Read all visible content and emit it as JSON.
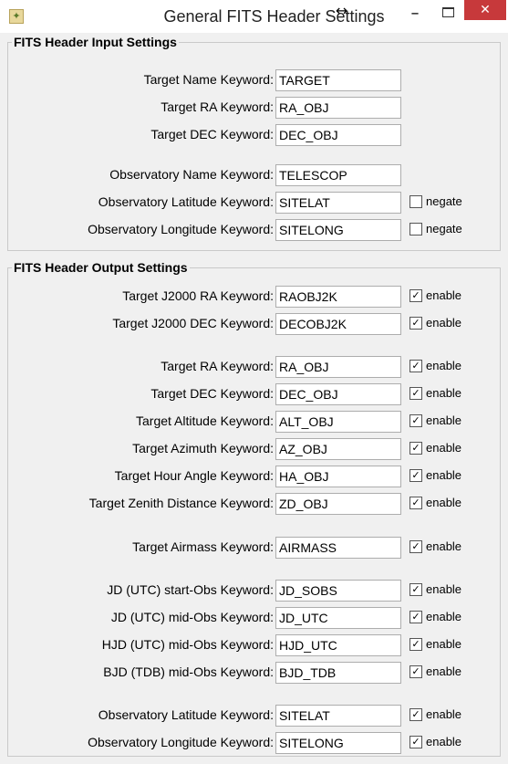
{
  "window": {
    "title": "General FITS Header Settings",
    "minimize_glyph": "–",
    "close_glyph": "✕",
    "resize_cursor_glyph": "↔"
  },
  "input_settings": {
    "legend": "FITS Header Input Settings",
    "rows": [
      {
        "label": "Target Name Keyword:",
        "value": "TARGET"
      },
      {
        "label": "Target RA Keyword:",
        "value": "RA_OBJ"
      },
      {
        "label": "Target DEC Keyword:",
        "value": "DEC_OBJ"
      },
      {
        "label": "Observatory Name Keyword:",
        "value": "TELESCOP"
      },
      {
        "label": "Observatory Latitude Keyword:",
        "value": "SITELAT",
        "checkbox_label": "negate",
        "checked": false
      },
      {
        "label": "Observatory Longitude Keyword:",
        "value": "SITELONG",
        "checkbox_label": "negate",
        "checked": false
      }
    ]
  },
  "output_settings": {
    "legend": "FITS Header Output Settings",
    "rows": [
      {
        "label": "Target J2000 RA Keyword:",
        "value": "RAOBJ2K",
        "checkbox_label": "enable",
        "checked": true
      },
      {
        "label": "Target J2000 DEC Keyword:",
        "value": "DECOBJ2K",
        "checkbox_label": "enable",
        "checked": true
      },
      {
        "label": "Target RA Keyword:",
        "value": "RA_OBJ",
        "checkbox_label": "enable",
        "checked": true
      },
      {
        "label": "Target DEC Keyword:",
        "value": "DEC_OBJ",
        "checkbox_label": "enable",
        "checked": true
      },
      {
        "label": "Target Altitude Keyword:",
        "value": "ALT_OBJ",
        "checkbox_label": "enable",
        "checked": true
      },
      {
        "label": "Target Azimuth Keyword:",
        "value": "AZ_OBJ",
        "checkbox_label": "enable",
        "checked": true
      },
      {
        "label": "Target Hour Angle Keyword:",
        "value": "HA_OBJ",
        "checkbox_label": "enable",
        "checked": true
      },
      {
        "label": "Target Zenith Distance Keyword:",
        "value": "ZD_OBJ",
        "checkbox_label": "enable",
        "checked": true
      },
      {
        "label": "Target Airmass Keyword:",
        "value": "AIRMASS",
        "checkbox_label": "enable",
        "checked": true
      },
      {
        "label": "JD (UTC) start-Obs Keyword:",
        "value": "JD_SOBS",
        "checkbox_label": "enable",
        "checked": true
      },
      {
        "label": "JD (UTC) mid-Obs Keyword:",
        "value": "JD_UTC",
        "checkbox_label": "enable",
        "checked": true
      },
      {
        "label": "HJD (UTC) mid-Obs Keyword:",
        "value": "HJD_UTC",
        "checkbox_label": "enable",
        "checked": true
      },
      {
        "label": "BJD (TDB) mid-Obs Keyword:",
        "value": "BJD_TDB",
        "checkbox_label": "enable",
        "checked": true
      },
      {
        "label": "Observatory Latitude Keyword:",
        "value": "SITELAT",
        "checkbox_label": "enable",
        "checked": true
      },
      {
        "label": "Observatory Longitude Keyword:",
        "value": "SITELONG",
        "checkbox_label": "enable",
        "checked": true
      }
    ]
  }
}
